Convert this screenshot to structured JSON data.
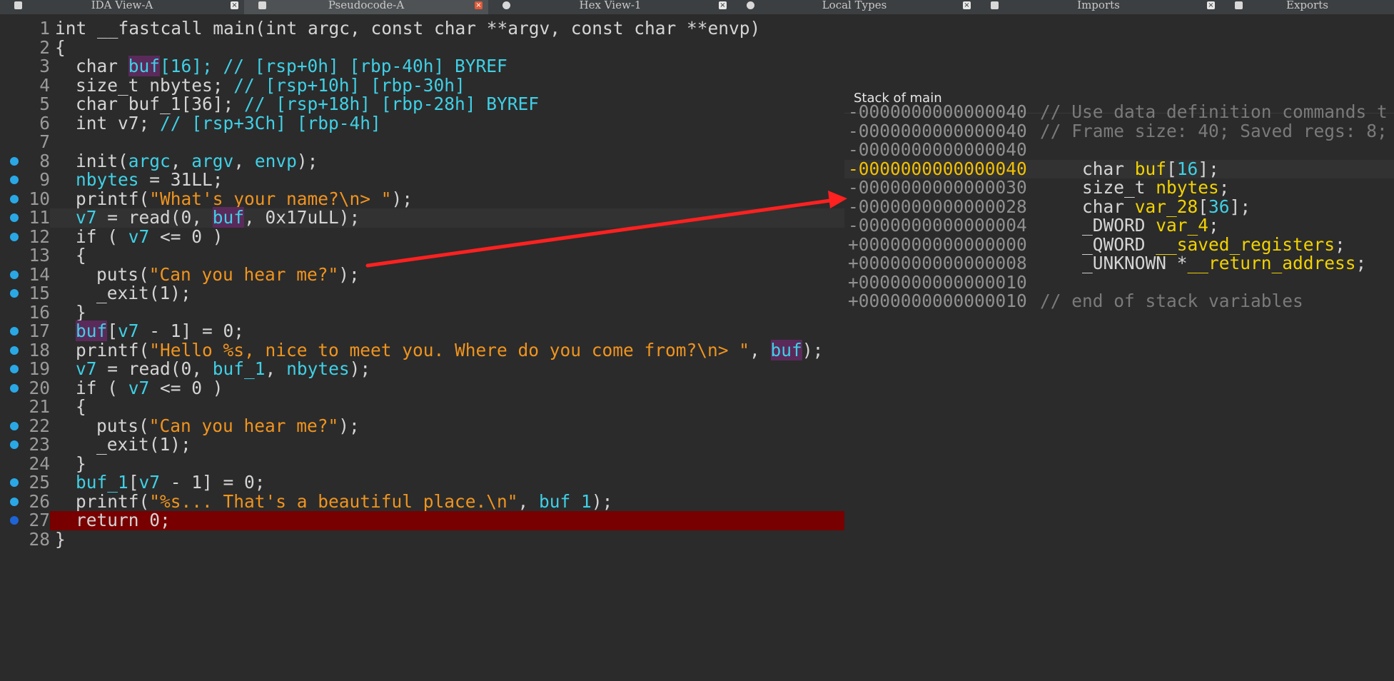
{
  "tabs": [
    {
      "label": "IDA View-A",
      "icon": "disasm-icon",
      "active": false,
      "closeRed": false
    },
    {
      "label": "Pseudocode-A",
      "icon": "pseudocode-icon",
      "active": true,
      "closeRed": true
    },
    {
      "label": "Hex View-1",
      "icon": "hex-icon",
      "active": false,
      "closeRed": false
    },
    {
      "label": "Local Types",
      "icon": "types-icon",
      "active": false,
      "closeRed": false
    },
    {
      "label": "Imports",
      "icon": "imports-icon",
      "active": false,
      "closeRed": false
    },
    {
      "label": "Exports",
      "icon": "exports-icon",
      "active": false,
      "closeRed": false
    }
  ],
  "pseudocode": {
    "lines": [
      {
        "n": "1",
        "indent": 0,
        "bp": false,
        "parts": [
          [
            "int __fastcall ",
            "kw"
          ],
          [
            "main",
            "kw"
          ],
          [
            "(int argc, const char **argv, const char **envp)",
            "kw"
          ]
        ]
      },
      {
        "n": "2",
        "indent": 0,
        "bp": false,
        "parts": [
          [
            "{",
            "kw"
          ]
        ]
      },
      {
        "n": "3",
        "indent": 1,
        "bp": false,
        "parts": [
          [
            "char ",
            "kw"
          ],
          [
            "buf",
            "hl"
          ],
          [
            "[16]; // [rsp+0h] [rbp-40h] BYREF",
            "cy"
          ]
        ]
      },
      {
        "n": "4",
        "indent": 1,
        "bp": false,
        "parts": [
          [
            "size_t nbytes; ",
            "kw"
          ],
          [
            "// [rsp+10h] [rbp-30h]",
            "cy"
          ]
        ]
      },
      {
        "n": "5",
        "indent": 1,
        "bp": false,
        "parts": [
          [
            "char buf_1[36]; ",
            "kw"
          ],
          [
            "// [rsp+18h] [rbp-28h] BYREF",
            "cy"
          ]
        ]
      },
      {
        "n": "6",
        "indent": 1,
        "bp": false,
        "parts": [
          [
            "int v7; ",
            "kw"
          ],
          [
            "// [rsp+3Ch] [rbp-4h]",
            "cy"
          ]
        ]
      },
      {
        "n": "7",
        "indent": 0,
        "bp": false,
        "parts": []
      },
      {
        "n": "8",
        "indent": 1,
        "bp": true,
        "parts": [
          [
            "init(",
            "kw"
          ],
          [
            "argc",
            "cy"
          ],
          [
            ", ",
            "kw"
          ],
          [
            "argv",
            "cy"
          ],
          [
            ", ",
            "kw"
          ],
          [
            "envp",
            "cy"
          ],
          [
            ");",
            "kw"
          ]
        ]
      },
      {
        "n": "9",
        "indent": 1,
        "bp": true,
        "parts": [
          [
            "nbytes",
            "cy"
          ],
          [
            " = 31LL;",
            "kw"
          ]
        ]
      },
      {
        "n": "10",
        "indent": 1,
        "bp": true,
        "parts": [
          [
            "printf(",
            "kw"
          ],
          [
            "\"What's your name?\\n> \"",
            "str"
          ],
          [
            ");",
            "kw"
          ]
        ]
      },
      {
        "n": "11",
        "indent": 1,
        "bp": true,
        "cursor": true,
        "parts": [
          [
            "v7",
            "cy"
          ],
          [
            " = read(0, ",
            "kw"
          ],
          [
            "buf",
            "hl"
          ],
          [
            ", 0x17uLL);",
            "kw"
          ]
        ]
      },
      {
        "n": "12",
        "indent": 1,
        "bp": true,
        "parts": [
          [
            "if ( ",
            "kw"
          ],
          [
            "v7",
            "cy"
          ],
          [
            " <= 0 )",
            "kw"
          ]
        ]
      },
      {
        "n": "13",
        "indent": 1,
        "bp": false,
        "parts": [
          [
            "{",
            "kw"
          ]
        ]
      },
      {
        "n": "14",
        "indent": 2,
        "bp": true,
        "parts": [
          [
            "puts(",
            "kw"
          ],
          [
            "\"Can you hear me?\"",
            "str"
          ],
          [
            ");",
            "kw"
          ]
        ]
      },
      {
        "n": "15",
        "indent": 2,
        "bp": true,
        "parts": [
          [
            "_exit(1);",
            "kw"
          ]
        ]
      },
      {
        "n": "16",
        "indent": 1,
        "bp": false,
        "parts": [
          [
            "}",
            "kw"
          ]
        ]
      },
      {
        "n": "17",
        "indent": 1,
        "bp": true,
        "parts": [
          [
            "buf",
            "hl"
          ],
          [
            "[",
            "kw"
          ],
          [
            "v7",
            "cy"
          ],
          [
            " - 1] = 0;",
            "kw"
          ]
        ]
      },
      {
        "n": "18",
        "indent": 1,
        "bp": true,
        "parts": [
          [
            "printf(",
            "kw"
          ],
          [
            "\"Hello %s, nice to meet you. Where do you come from?\\n> \"",
            "str"
          ],
          [
            ", ",
            "kw"
          ],
          [
            "buf",
            "hl"
          ],
          [
            ");",
            "kw"
          ]
        ]
      },
      {
        "n": "19",
        "indent": 1,
        "bp": true,
        "parts": [
          [
            "v7",
            "cy"
          ],
          [
            " = read(0, ",
            "kw"
          ],
          [
            "buf_1",
            "cy"
          ],
          [
            ", ",
            "kw"
          ],
          [
            "nbytes",
            "cy"
          ],
          [
            ");",
            "kw"
          ]
        ]
      },
      {
        "n": "20",
        "indent": 1,
        "bp": true,
        "parts": [
          [
            "if ( ",
            "kw"
          ],
          [
            "v7",
            "cy"
          ],
          [
            " <= 0 )",
            "kw"
          ]
        ]
      },
      {
        "n": "21",
        "indent": 1,
        "bp": false,
        "parts": [
          [
            "{",
            "kw"
          ]
        ]
      },
      {
        "n": "22",
        "indent": 2,
        "bp": true,
        "parts": [
          [
            "puts(",
            "kw"
          ],
          [
            "\"Can you hear me?\"",
            "str"
          ],
          [
            ");",
            "kw"
          ]
        ]
      },
      {
        "n": "23",
        "indent": 2,
        "bp": true,
        "parts": [
          [
            "_exit(1);",
            "kw"
          ]
        ]
      },
      {
        "n": "24",
        "indent": 1,
        "bp": false,
        "parts": [
          [
            "}",
            "kw"
          ]
        ]
      },
      {
        "n": "25",
        "indent": 1,
        "bp": true,
        "parts": [
          [
            "buf_1",
            "cy"
          ],
          [
            "[",
            "kw"
          ],
          [
            "v7",
            "cy"
          ],
          [
            " - 1] = 0;",
            "kw"
          ]
        ]
      },
      {
        "n": "26",
        "indent": 1,
        "bp": true,
        "parts": [
          [
            "printf(",
            "kw"
          ],
          [
            "\"%s... That's a beautiful place.\\n\"",
            "str"
          ],
          [
            ", ",
            "kw"
          ],
          [
            "buf_1",
            "cy"
          ],
          [
            ");",
            "kw"
          ]
        ]
      },
      {
        "n": "27",
        "indent": 1,
        "bp": true,
        "bpCur": true,
        "breakpointLine": true,
        "parts": [
          [
            "return 0;",
            "kw"
          ]
        ]
      },
      {
        "n": "28",
        "indent": 0,
        "bp": false,
        "parts": [
          [
            "}",
            "kw"
          ]
        ]
      }
    ]
  },
  "stack": {
    "title": "Stack of main",
    "lines": [
      {
        "off": "-0000000000000040",
        "comment": "// Use data definition commands t"
      },
      {
        "off": "-0000000000000040",
        "comment": "// Frame size: 40; Saved regs: 8;"
      },
      {
        "off": "-0000000000000040"
      },
      {
        "off": "-0000000000000040",
        "yellow": true,
        "cursor": true,
        "decl": [
          [
            "char ",
            "kw"
          ],
          [
            "buf",
            "name"
          ],
          [
            "[",
            "kw"
          ],
          [
            "16",
            "num"
          ],
          [
            "];",
            "kw"
          ]
        ]
      },
      {
        "off": "-0000000000000030",
        "decl": [
          [
            "size_t ",
            "kw"
          ],
          [
            "nbytes",
            "name"
          ],
          [
            ";",
            "kw"
          ]
        ]
      },
      {
        "off": "-0000000000000028",
        "decl": [
          [
            "char ",
            "kw"
          ],
          [
            "var_28",
            "name"
          ],
          [
            "[",
            "kw"
          ],
          [
            "36",
            "num"
          ],
          [
            "];",
            "kw"
          ]
        ]
      },
      {
        "off": "-0000000000000004",
        "decl": [
          [
            "_DWORD ",
            "kw"
          ],
          [
            "var_4",
            "name"
          ],
          [
            ";",
            "kw"
          ]
        ]
      },
      {
        "off": "+0000000000000000",
        "decl": [
          [
            "_QWORD ",
            "kw"
          ],
          [
            "__saved_registers",
            "name"
          ],
          [
            ";",
            "kw"
          ]
        ]
      },
      {
        "off": "+0000000000000008",
        "decl": [
          [
            "_UNKNOWN *",
            "kw"
          ],
          [
            "__return_address",
            "name"
          ],
          [
            ";",
            "kw"
          ]
        ]
      },
      {
        "off": "+0000000000000010"
      },
      {
        "off": "+0000000000000010",
        "comment": "// end of stack variables"
      }
    ]
  },
  "colors": {
    "background": "#2b2b2b",
    "identifier": "#3fd0e6",
    "string": "#f0941e",
    "highlight": "#5a2a5a",
    "breakpoint_line": "#780000",
    "breakpoint_dot": "#2aa8e6",
    "stack_name": "#f2d200",
    "arrow": "#ff2020"
  }
}
